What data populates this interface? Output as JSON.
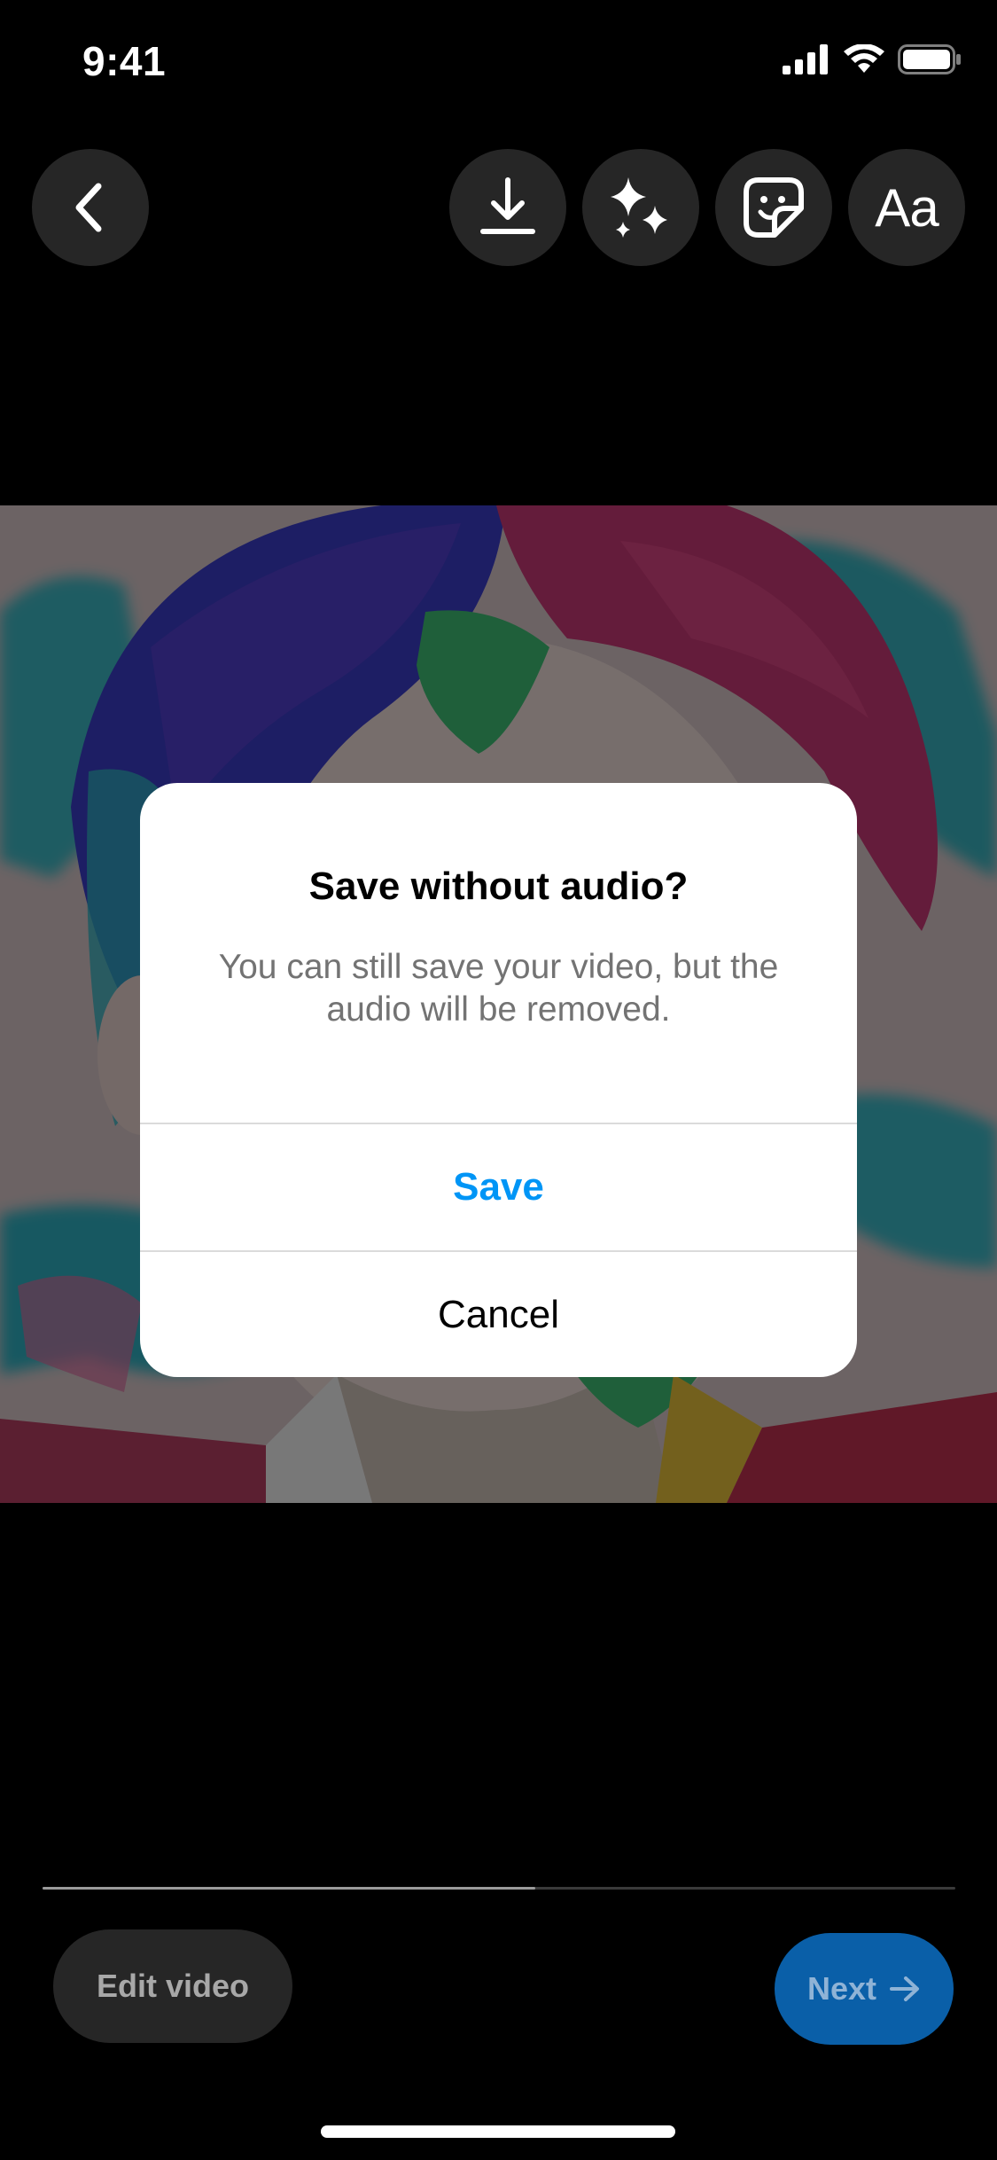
{
  "status_bar": {
    "time": "9:41"
  },
  "toolbar": {
    "back_icon": "chevron-left-icon",
    "download_icon": "download-icon",
    "effects_icon": "sparkles-icon",
    "sticker_icon": "sticker-icon",
    "text_label": "Aa"
  },
  "playback": {
    "progress": 0.54
  },
  "bottom": {
    "edit_label": "Edit video",
    "next_label": "Next",
    "next_icon": "arrow-right-icon"
  },
  "dialog": {
    "title": "Save without audio?",
    "message": "You can still save your video, but the audio will be removed.",
    "save_label": "Save",
    "cancel_label": "Cancel"
  },
  "colors": {
    "background": "#000000",
    "accent_blue": "#0095f6",
    "next_button": "#0a5fa8",
    "button_dark": "#262626",
    "secondary_text": "#737373"
  }
}
